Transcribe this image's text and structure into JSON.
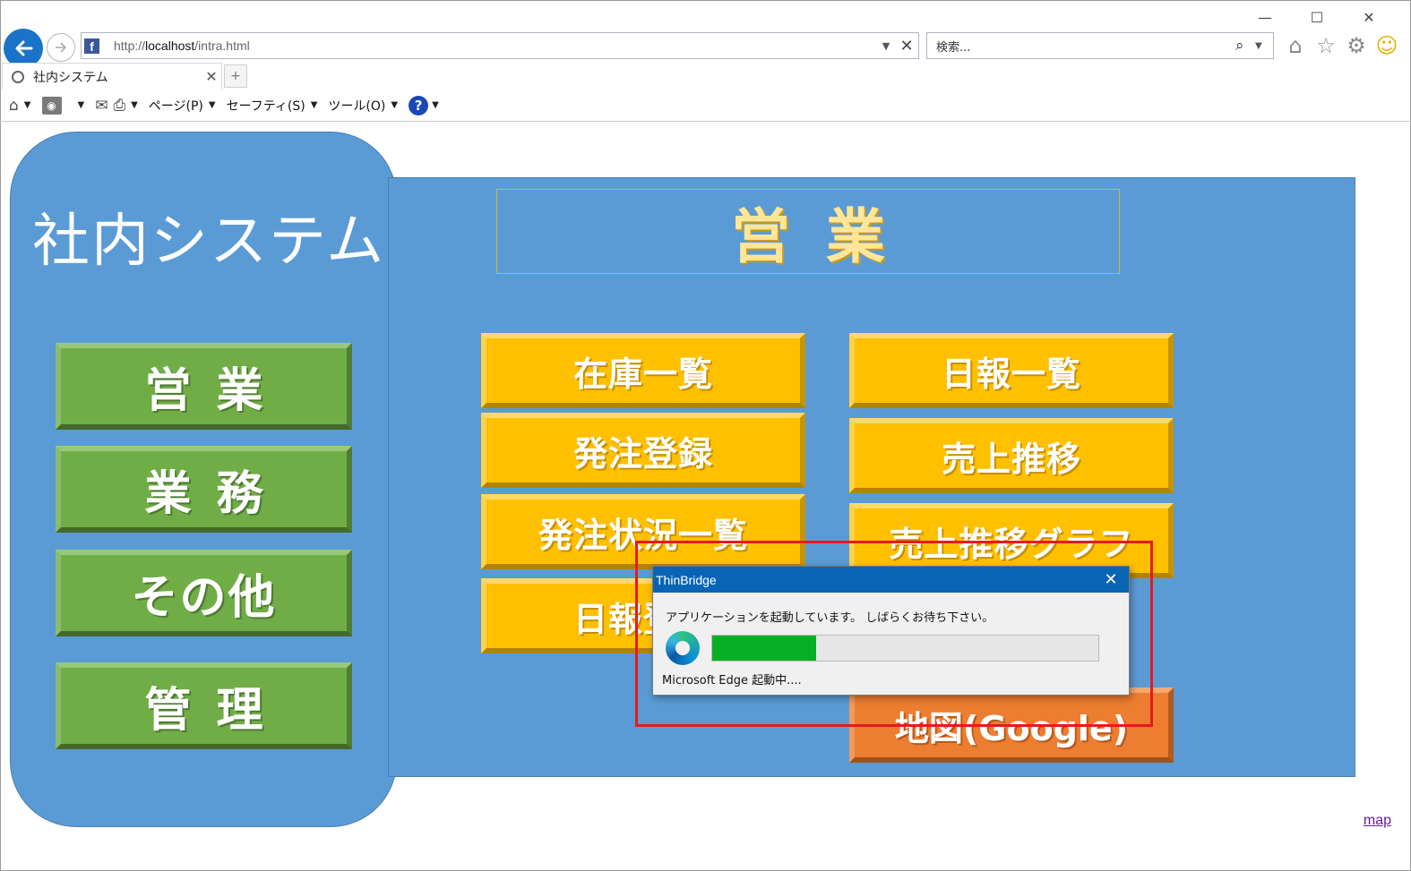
{
  "browser": {
    "url_prefix": "http://",
    "url_host": "localhost",
    "url_path": "/intra.html",
    "search_placeholder": "検索...",
    "tab_title": "社内システム",
    "menus": {
      "page": "ページ(P)",
      "safety": "セーフティ(S)",
      "tools": "ツール(O)"
    },
    "icons": [
      "back-arrow-icon",
      "forward-arrow-icon",
      "facebook-icon",
      "search-icon",
      "home-icon",
      "favorites-star-icon",
      "gear-icon",
      "smiley-icon",
      "rss-icon",
      "mail-icon",
      "print-icon",
      "help-icon"
    ]
  },
  "page": {
    "left_title": "社内システム",
    "section_title": "営業",
    "nav_buttons": [
      "営業",
      "業務",
      "その他",
      "管理"
    ],
    "menu_buttons": [
      "在庫一覧",
      "日報一覧",
      "発注登録",
      "売上推移",
      "発注状況一覧",
      "売上推移グラフ",
      "日報登録",
      "地図(Google)"
    ],
    "map_link": "map",
    "colors": {
      "panel_blue": "#5b9bd5",
      "nav_green": "#70ad47",
      "menu_gold": "#ffc000",
      "map_orange": "#ed7d31"
    }
  },
  "dialog": {
    "title": "ThinBridge",
    "message": "アプリケーションを起動しています。 しばらくお待ち下さい。",
    "status": "Microsoft Edge 起動中....",
    "progress_percent": 27,
    "highlight_color": "#e8191e"
  }
}
